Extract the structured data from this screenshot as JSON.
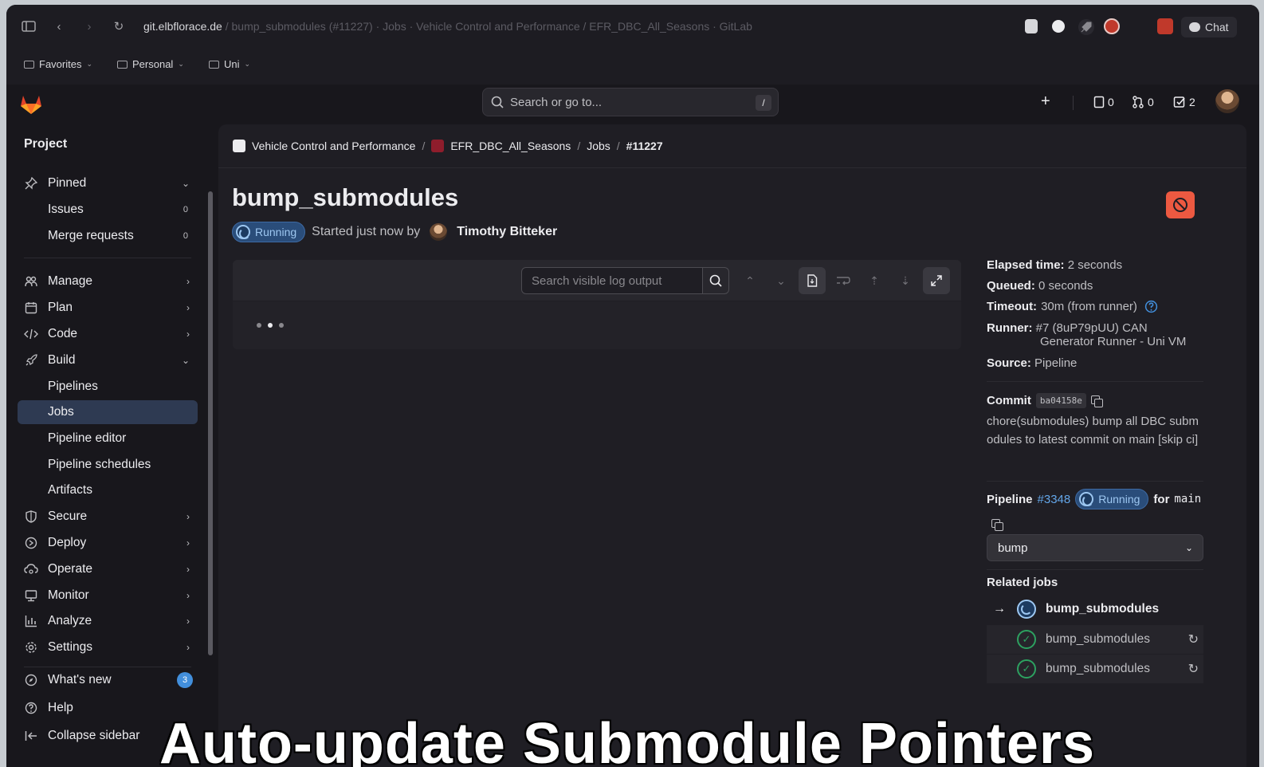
{
  "browser": {
    "url_host": "git.elbflorace.de",
    "url_rest": " / bump_submodules (#11227) · Jobs · Vehicle Control and Performance / EFR_DBC_All_Seasons · GitLab",
    "chat_label": "Chat",
    "bookmarks": [
      {
        "label": "Favorites"
      },
      {
        "label": "Personal"
      },
      {
        "label": "Uni"
      }
    ]
  },
  "topbar": {
    "search_placeholder": "Search or go to...",
    "search_shortcut": "/",
    "issues_count": "0",
    "mr_count": "0",
    "todo_count": "2"
  },
  "sidebar": {
    "title": "Project",
    "pinned": {
      "label": "Pinned",
      "items": [
        {
          "label": "Issues",
          "count": "0"
        },
        {
          "label": "Merge requests",
          "count": "0"
        }
      ]
    },
    "manage": "Manage",
    "plan": "Plan",
    "code": "Code",
    "build": "Build",
    "build_items": [
      "Pipelines",
      "Jobs",
      "Pipeline editor",
      "Pipeline schedules",
      "Artifacts"
    ],
    "secure": "Secure",
    "deploy": "Deploy",
    "operate": "Operate",
    "monitor": "Monitor",
    "analyze": "Analyze",
    "settings": "Settings",
    "whats_new": "What's new",
    "whats_new_count": "3",
    "help": "Help",
    "collapse": "Collapse sidebar"
  },
  "breadcrumb": {
    "group": "Vehicle Control and Performance",
    "project": "EFR_DBC_All_Seasons",
    "jobs": "Jobs",
    "current": "#11227"
  },
  "job": {
    "title": "bump_submodules",
    "status": "Running",
    "started_text": "Started just now by",
    "author": "Timothy Bitteker"
  },
  "log": {
    "search_placeholder": "Search visible log output"
  },
  "details": {
    "elapsed_label": "Elapsed time:",
    "elapsed_value": "2 seconds",
    "queued_label": "Queued:",
    "queued_value": "0 seconds",
    "timeout_label": "Timeout:",
    "timeout_value": "30m (from runner)",
    "runner_label": "Runner:",
    "runner_value_1": "#7 (8uP79pUU) CAN",
    "runner_value_2": "Generator Runner - Uni VM",
    "source_label": "Source:",
    "source_value": "Pipeline",
    "commit_label": "Commit",
    "commit_sha": "ba04158e",
    "commit_message": "chore(submodules) bump all DBC submodules to latest commit on main [skip ci]",
    "pipeline_label": "Pipeline",
    "pipeline_id": "#3348",
    "pipeline_status": "Running",
    "pipeline_for": "for",
    "pipeline_branch": "main",
    "stage": "bump",
    "related_label": "Related jobs",
    "related_jobs": [
      {
        "name": "bump_submodules"
      },
      {
        "name": "bump_submodules"
      },
      {
        "name": "bump_submodules"
      }
    ]
  },
  "caption": "Auto-update Submodule Pointers",
  "colors": {
    "accent": "#428fdc",
    "danger": "#ec5941",
    "success": "#2da160",
    "running": "#9dc7f1"
  }
}
